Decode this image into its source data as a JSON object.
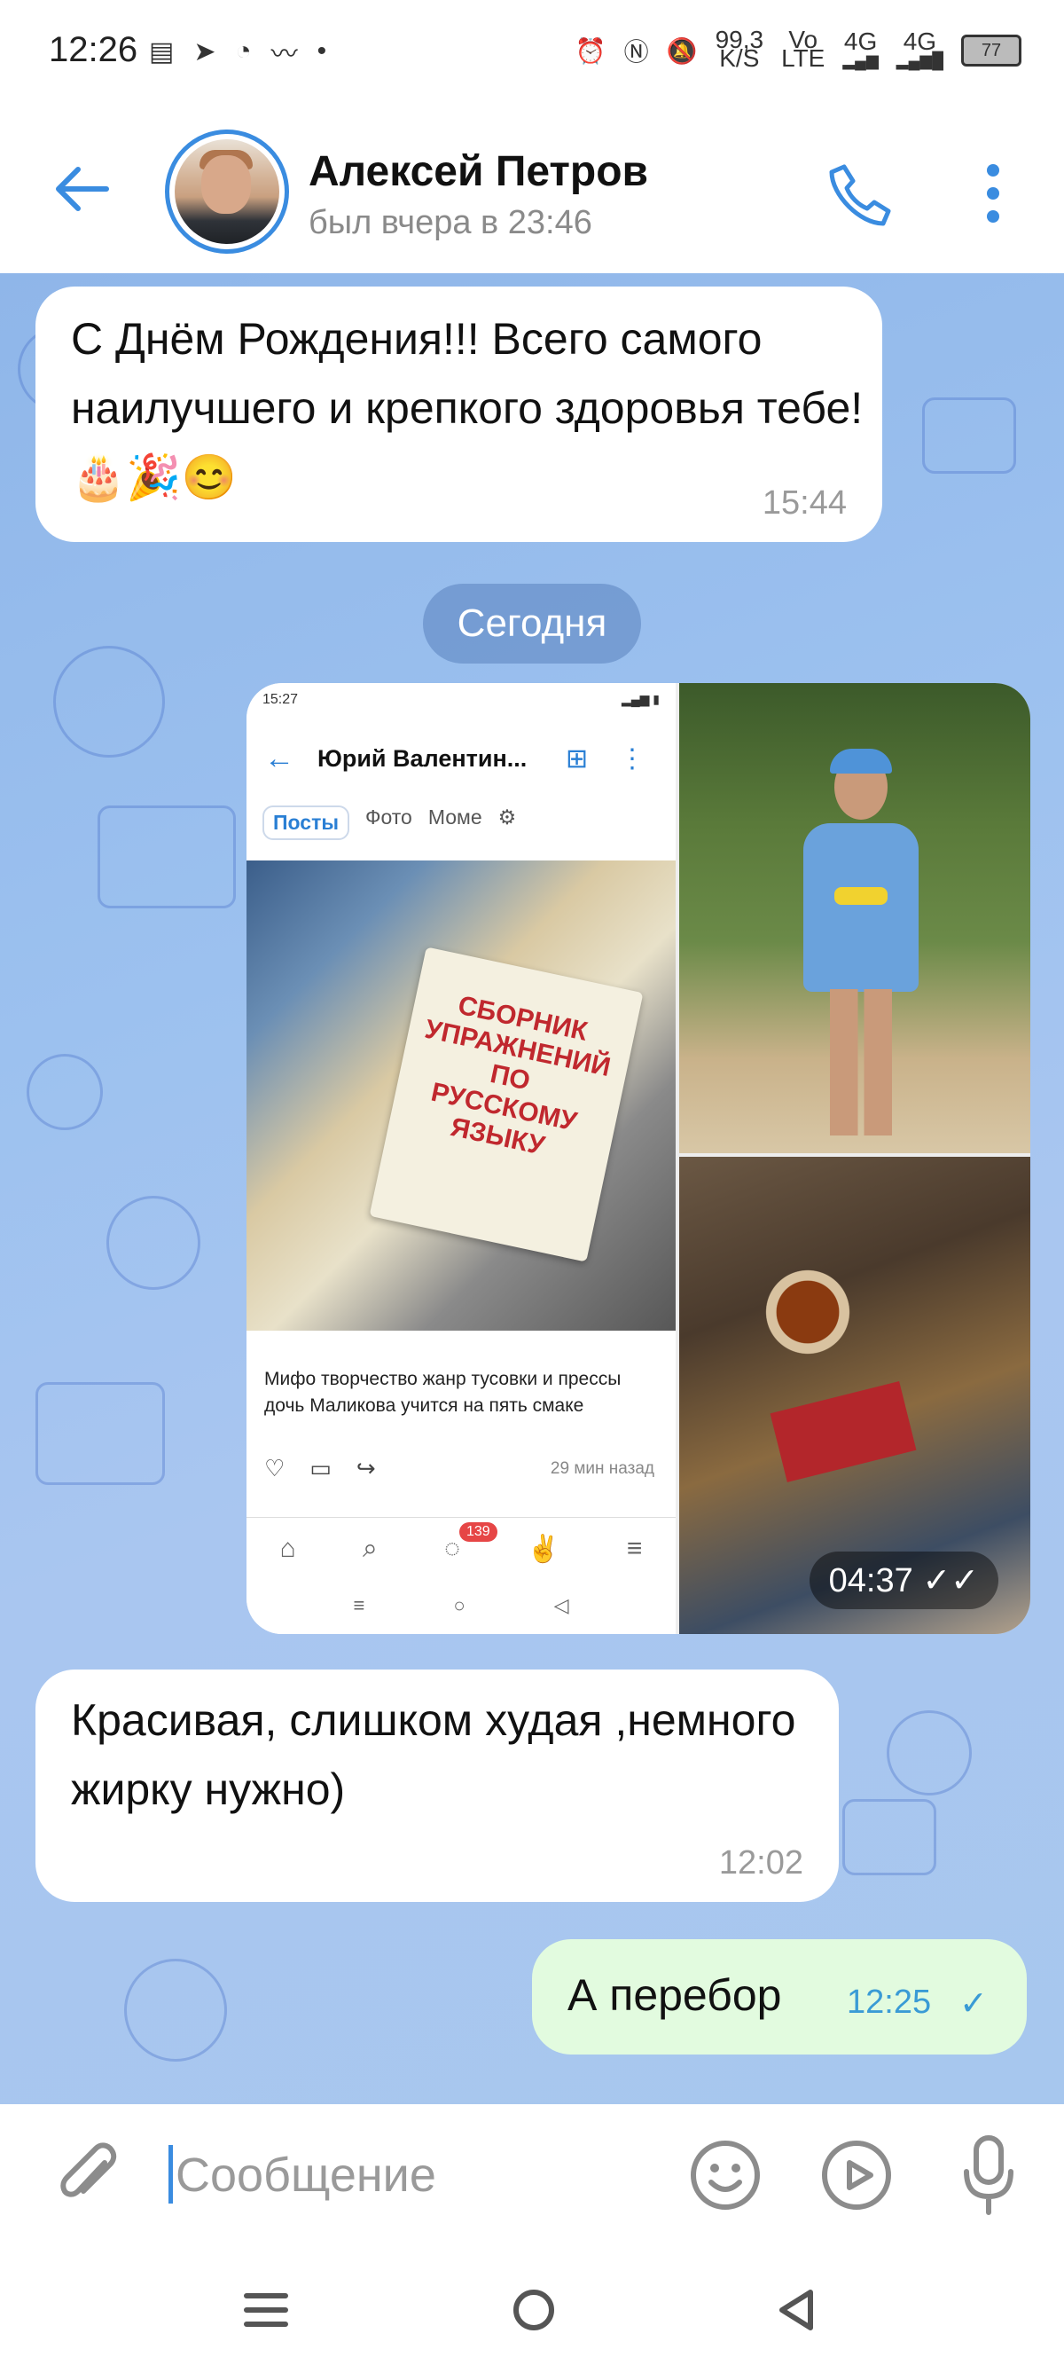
{
  "status_bar": {
    "time": "12:26",
    "speed_value": "99,3",
    "speed_unit": "K/S",
    "volte_top": "Vo",
    "volte_bottom": "LTE",
    "net1": "4G",
    "net2": "4G",
    "battery": "77"
  },
  "header": {
    "contact_name": "Алексей Петров",
    "contact_status": "был вчера в 23:46"
  },
  "messages": [
    {
      "text": "С Днём Рождения!!! Всего самого наилучшего и крепкого здоровья тебе! 🎂🎉😊",
      "time": "15:44"
    },
    {
      "text": "Красивая, слишком худая ,немного жирку нужно)",
      "time": "12:02"
    },
    {
      "text": "А перебор",
      "time": "12:25"
    }
  ],
  "date_separator": "Сегодня",
  "media": {
    "time": "04:37",
    "screenshot": {
      "status_time": "15:27",
      "title": "Юрий Валентин...",
      "tabs": [
        "Посты",
        "Фото",
        "Моме"
      ],
      "book_title": "СБОРНИК УПРАЖНЕНИЙ ПО РУССКОМУ ЯЗЫКУ",
      "caption": "Мифо творчество жанр тусовки и прессы дочь Маликова учится на пять смаке",
      "posted_ago": "29 мин назад",
      "badge": "139"
    }
  },
  "composer": {
    "placeholder": "Сообщение"
  },
  "colors": {
    "accent": "#3a8ce0",
    "chat_bg": "#9cc1ef",
    "outgoing_bubble": "#e2fbdf"
  }
}
